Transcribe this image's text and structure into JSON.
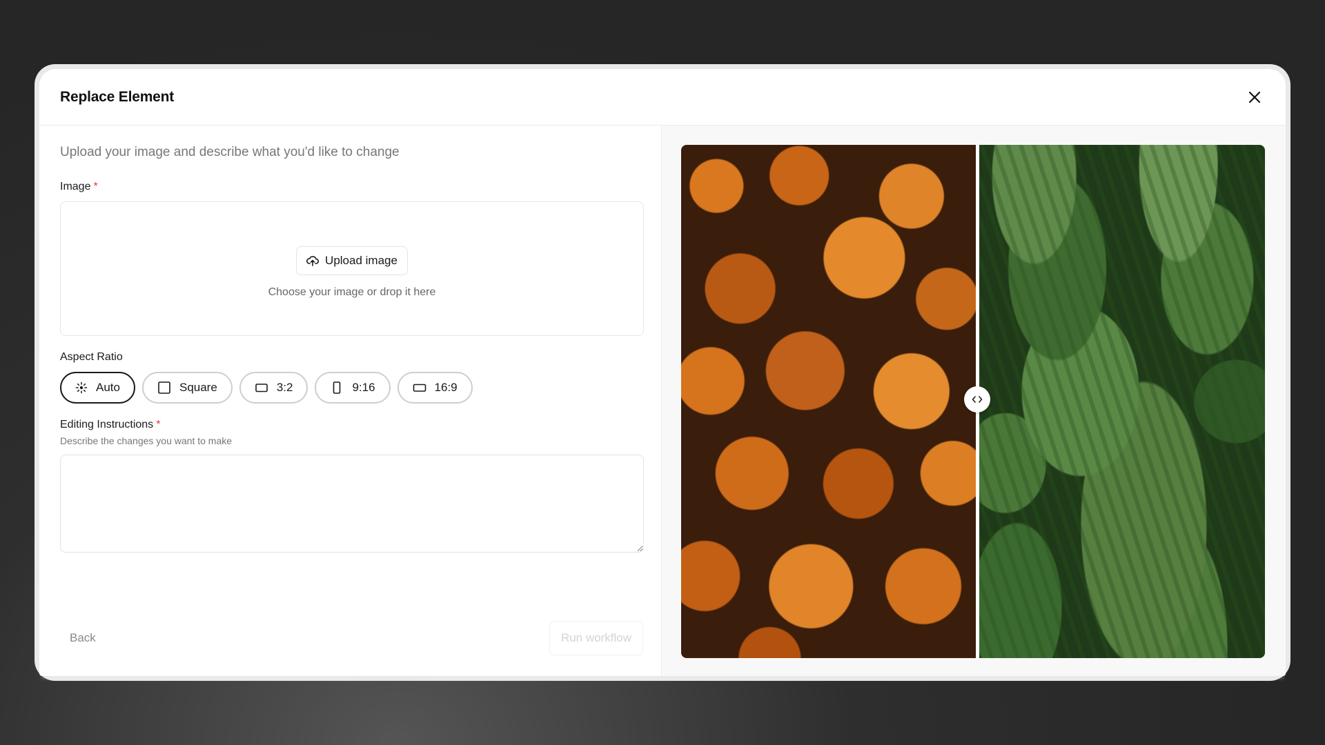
{
  "modal": {
    "title": "Replace Element",
    "subtitle": "Upload your image and describe what you'd like to change"
  },
  "image_field": {
    "label": "Image",
    "required_mark": "*",
    "upload_button": "Upload image",
    "drop_hint": "Choose your image or drop it here"
  },
  "aspect_ratio": {
    "label": "Aspect Ratio",
    "selected": "Auto",
    "options": [
      {
        "label": "Auto",
        "icon": "auto-icon"
      },
      {
        "label": "Square",
        "icon": "square-icon"
      },
      {
        "label": "3:2",
        "icon": "landscape-icon"
      },
      {
        "label": "9:16",
        "icon": "portrait-icon"
      },
      {
        "label": "16:9",
        "icon": "widescreen-icon"
      }
    ]
  },
  "instructions": {
    "label": "Editing Instructions",
    "required_mark": "*",
    "helper": "Describe the changes you want to make",
    "value": ""
  },
  "footer": {
    "back_label": "Back",
    "run_label": "Run workflow"
  },
  "preview": {
    "before_subject": "pumpkins",
    "after_subject": "watermelons"
  },
  "colors": {
    "required": "#e53935",
    "active_border": "#1a1a1a",
    "disabled_text": "#d4d4d4"
  }
}
